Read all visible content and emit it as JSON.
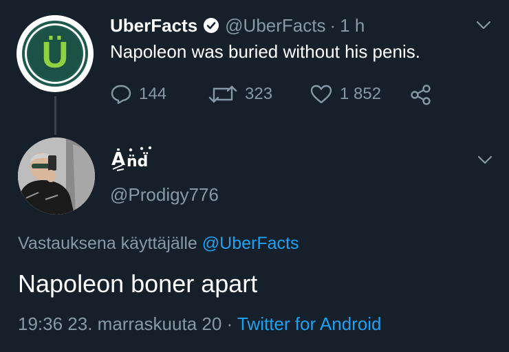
{
  "tweet": {
    "display_name": "UberFacts",
    "handle": "@UberFacts",
    "time": "1 h",
    "separator": "·",
    "text": "Napoleon was buried without his penis.",
    "avatar_letter": "Ü",
    "replies": "144",
    "retweets": "323",
    "likes": "1 852",
    "icons": [
      "reply-icon",
      "retweet-icon",
      "like-icon",
      "share-icon",
      "verified-icon",
      "chevron-down-icon"
    ]
  },
  "reply": {
    "display_name_note": "stylized glyph name rendered as picture",
    "handle": "@Prodigy776",
    "replying_prefix": "Vastauksena käyttäjälle",
    "replying_to": "@UberFacts",
    "text": "Napoleon boner apart",
    "timestamp": "19:36 23. marraskuuta 20",
    "separator": "·",
    "source": "Twitter for Android"
  },
  "colors": {
    "background": "#15202b",
    "muted": "#8899a6",
    "link": "#1da1f2",
    "brand_green": "#8fd13f"
  }
}
